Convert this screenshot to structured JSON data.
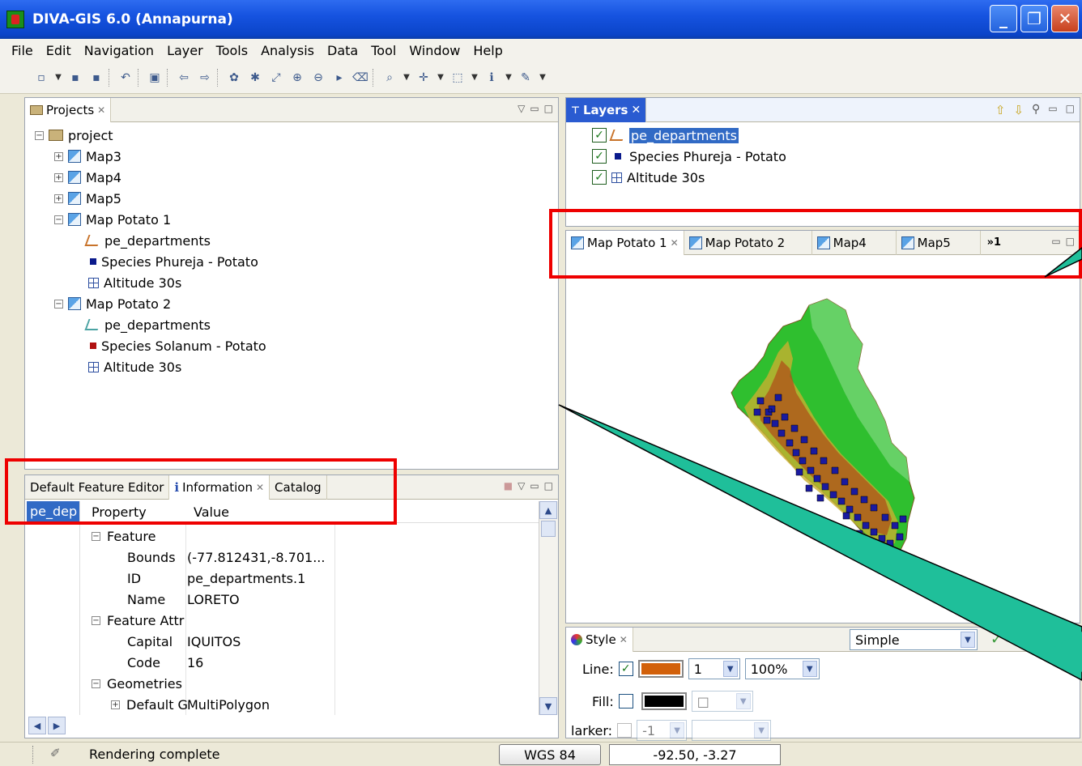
{
  "window": {
    "title": "DIVA-GIS 6.0 (Annapurna)",
    "min": "_",
    "max": "❐",
    "close": "✕"
  },
  "menu": [
    "File",
    "Edit",
    "Navigation",
    "Layer",
    "Tools",
    "Analysis",
    "Data",
    "Tool",
    "Window",
    "Help"
  ],
  "projects": {
    "tab_label": "Projects",
    "root": "project",
    "items": [
      {
        "label": "Map3",
        "level": 1,
        "type": "map",
        "expander": "+"
      },
      {
        "label": "Map4",
        "level": 1,
        "type": "map",
        "expander": "+"
      },
      {
        "label": "Map5",
        "level": 1,
        "type": "map",
        "expander": "+"
      },
      {
        "label": "Map Potato 1",
        "level": 1,
        "type": "map",
        "expander": "-"
      },
      {
        "label": "pe_departments",
        "level": 2,
        "type": "poly"
      },
      {
        "label": "Species Phureja - Potato",
        "level": 2,
        "type": "point"
      },
      {
        "label": "Altitude 30s",
        "level": 2,
        "type": "grid"
      },
      {
        "label": "Map Potato 2",
        "level": 1,
        "type": "map",
        "expander": "-"
      },
      {
        "label": "pe_departments",
        "level": 2,
        "type": "poly-teal"
      },
      {
        "label": "Species Solanum - Potato",
        "level": 2,
        "type": "point-red"
      },
      {
        "label": "Altitude 30s",
        "level": 2,
        "type": "grid"
      }
    ]
  },
  "layers": {
    "tab_label": "Layers",
    "tab_close": "✕",
    "items": [
      {
        "label": "pe_departments",
        "type": "poly",
        "selected": true
      },
      {
        "label": "Species Phureja - Potato",
        "type": "point"
      },
      {
        "label": "Altitude 30s",
        "type": "grid"
      }
    ]
  },
  "map_tabs": [
    "Map Potato 1",
    "Map Potato 2",
    "Map4",
    "Map5"
  ],
  "map_tabs_overflow": "»1",
  "info": {
    "tabs": [
      "Default Feature Editor",
      "Information",
      "Catalog"
    ],
    "left_item": "pe_dep",
    "headers": {
      "property": "Property",
      "value": "Value"
    },
    "rows": [
      {
        "indent": 0,
        "expander": "-",
        "property": "Feature",
        "value": ""
      },
      {
        "indent": 1,
        "property": "Bounds",
        "value": "(-77.812431,-8.701..."
      },
      {
        "indent": 1,
        "property": "ID",
        "value": "pe_departments.1"
      },
      {
        "indent": 1,
        "property": "Name",
        "value": "LORETO"
      },
      {
        "indent": 0,
        "expander": "-",
        "property": "Feature Attr",
        "value": ""
      },
      {
        "indent": 1,
        "property": "Capital",
        "value": "IQUITOS"
      },
      {
        "indent": 1,
        "property": "Code",
        "value": "16"
      },
      {
        "indent": 0,
        "expander": "-",
        "property": "Geometries",
        "value": ""
      },
      {
        "indent": 1,
        "expander": "+",
        "property": "Default G",
        "value": "MultiPolygon"
      }
    ]
  },
  "style": {
    "tab_label": "Style",
    "mode": "Simple",
    "line_label": "Line:",
    "line_color": "#d2600a",
    "line_width": "1",
    "line_opacity": "100%",
    "fill_label": "Fill:",
    "fill_color": "#000000",
    "marker_label": "larker:",
    "marker_size": "-1"
  },
  "status": {
    "text": "Rendering complete",
    "crs": "WGS 84",
    "coords": "-92.50, -3.27"
  }
}
